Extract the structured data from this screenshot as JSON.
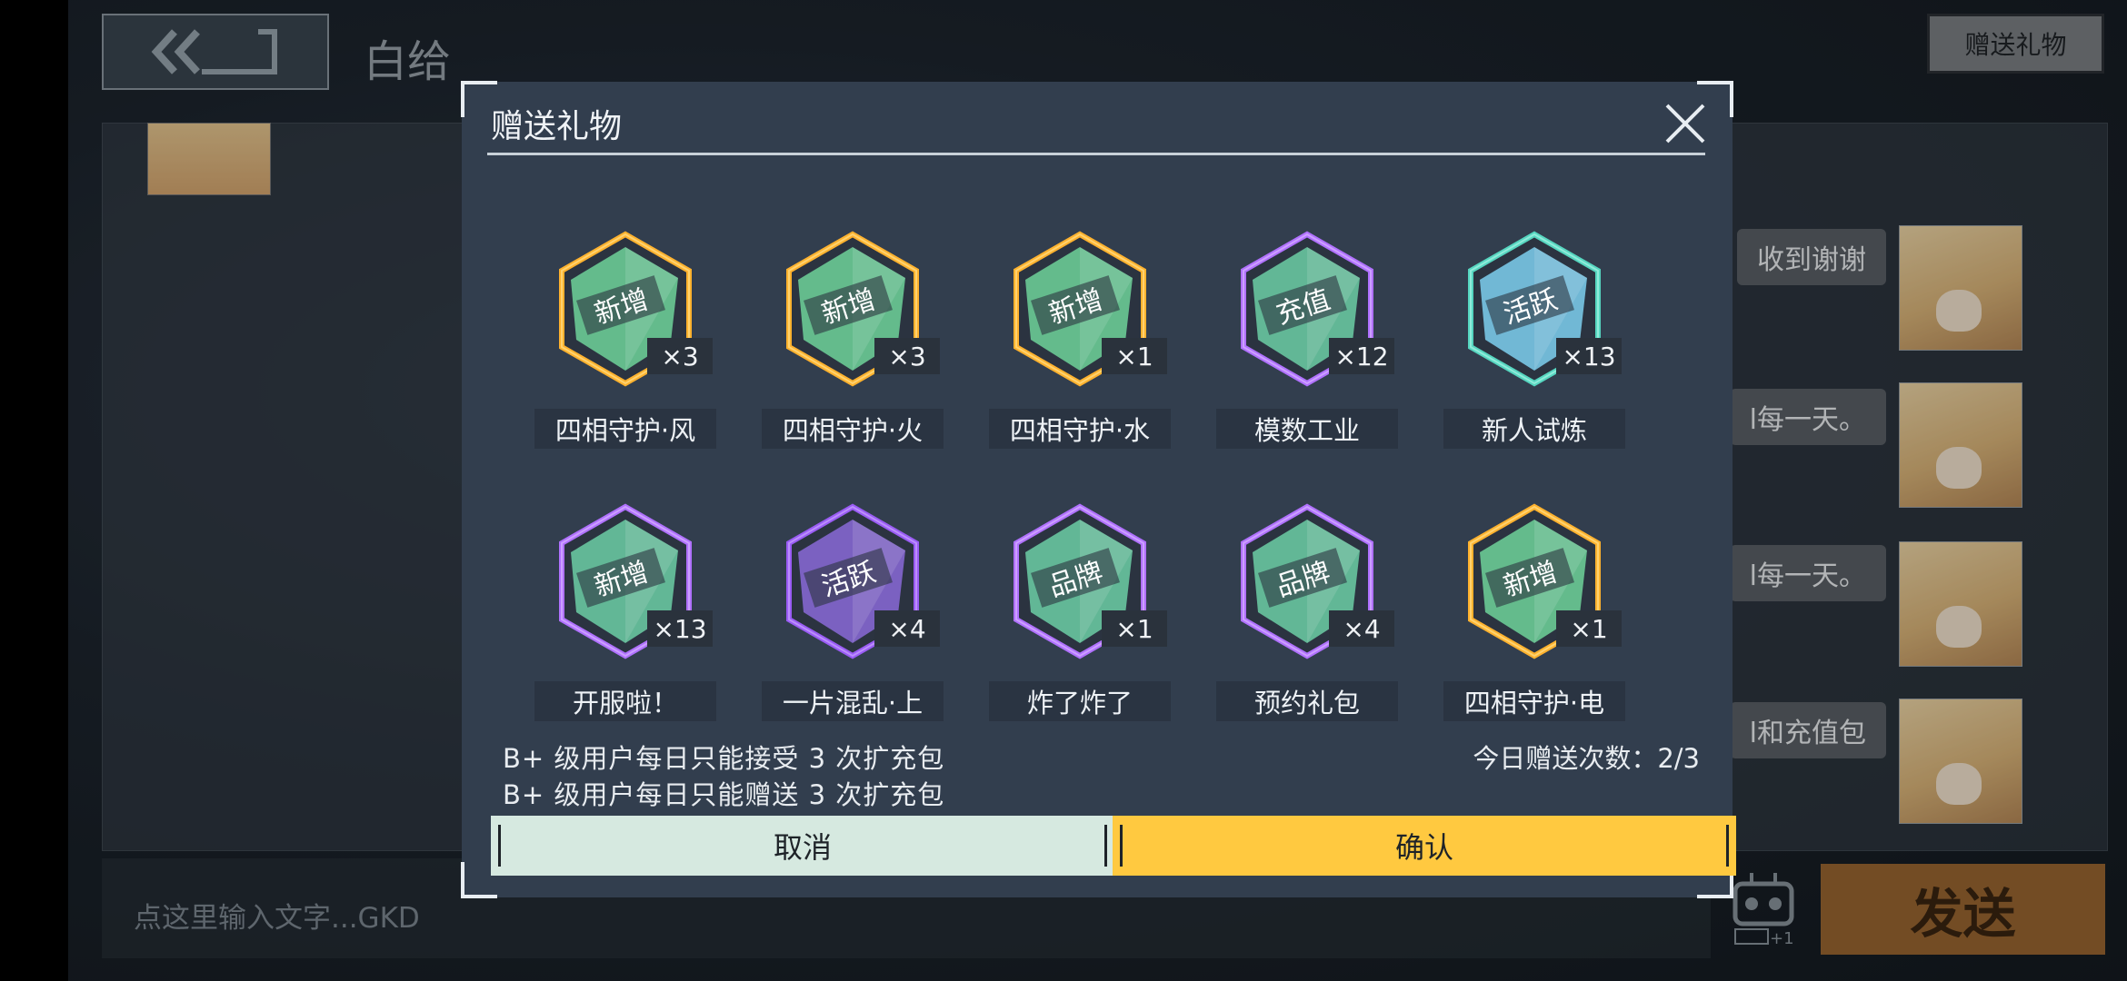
{
  "header": {
    "contact_name": "白给",
    "gift_button_label": "赠送礼物"
  },
  "chat": {
    "messages": [
      {
        "text": "收到谢谢"
      },
      {
        "text": "l每一天。"
      },
      {
        "text": "l每一天。"
      },
      {
        "text": "l和充值包"
      }
    ]
  },
  "input": {
    "placeholder": "点这里输入文字...GKD",
    "send_label": "发送",
    "bot_badge": "+1"
  },
  "modal": {
    "title": "赠送礼物",
    "gifts": [
      {
        "name": "四相守护·风",
        "tag": "新增",
        "count": "×3",
        "color": "gold"
      },
      {
        "name": "四相守护·火",
        "tag": "新增",
        "count": "×3",
        "color": "gold"
      },
      {
        "name": "四相守护·水",
        "tag": "新增",
        "count": "×1",
        "color": "gold"
      },
      {
        "name": "模数工业",
        "tag": "充值",
        "count": "×12",
        "color": "purple"
      },
      {
        "name": "新人试炼",
        "tag": "活跃",
        "count": "×13",
        "color": "teal"
      },
      {
        "name": "开服啦！",
        "tag": "新增",
        "count": "×13",
        "color": "purple"
      },
      {
        "name": "一片混乱·上",
        "tag": "活跃",
        "count": "×4",
        "color": "violet"
      },
      {
        "name": "炸了炸了",
        "tag": "品牌",
        "count": "×1",
        "color": "purple"
      },
      {
        "name": "预约礼包",
        "tag": "品牌",
        "count": "×4",
        "color": "purple"
      },
      {
        "name": "四相守护·电",
        "tag": "新增",
        "count": "×1",
        "color": "gold"
      }
    ],
    "rule_receive": "B+ 级用户每日只能接受 3 次扩充包",
    "rule_send": "B+ 级用户每日只能赠送 3 次扩充包",
    "today_count": "今日赠送次数：2/3",
    "cancel_label": "取消",
    "confirm_label": "确认"
  }
}
